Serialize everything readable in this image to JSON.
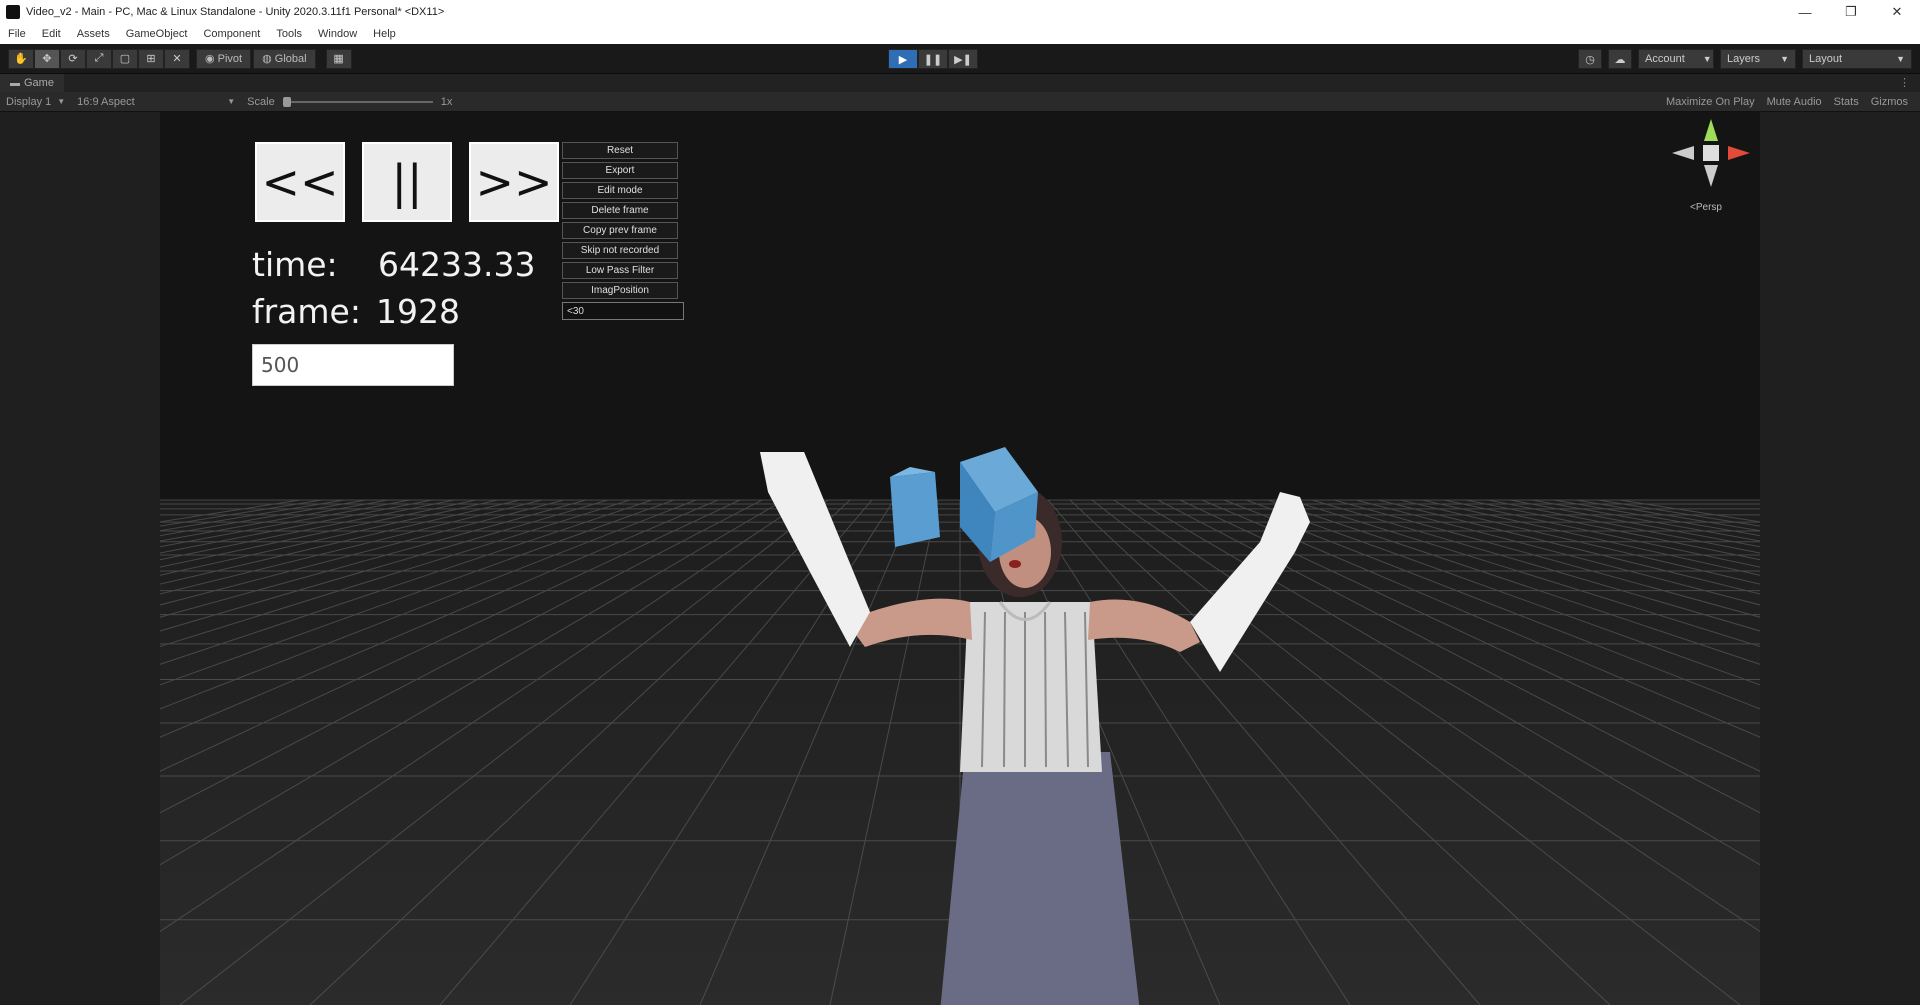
{
  "window": {
    "title": "Video_v2 - Main - PC, Mac & Linux Standalone - Unity 2020.3.11f1 Personal* <DX11>",
    "controls": [
      "—",
      "❐",
      "✕"
    ]
  },
  "menu": {
    "items": [
      "File",
      "Edit",
      "Assets",
      "GameObject",
      "Component",
      "Tools",
      "Window",
      "Help"
    ]
  },
  "toolbar": {
    "pivot_label": "Pivot",
    "global_label": "Global",
    "account_label": "Account",
    "layers_label": "Layers",
    "layout_label": "Layout"
  },
  "game_tab": {
    "label": "Game",
    "menu_icon": "⋮"
  },
  "game_options": {
    "display": "Display 1",
    "aspect": "16:9 Aspect",
    "scale_label": "Scale",
    "scale_value": "1x",
    "maximize": "Maximize On Play",
    "mute": "Mute Audio",
    "stats": "Stats",
    "gizmos": "Gizmos"
  },
  "hud": {
    "prev_label": "<<",
    "pause_label": "||",
    "next_label": ">>",
    "time_label": "time:",
    "time_value": "64233.33",
    "frame_label": "frame:",
    "frame_value": "1928",
    "input_value": "500"
  },
  "side_menu": {
    "items": [
      "Reset",
      "Export",
      "Edit mode",
      "Delete frame",
      "Copy prev frame",
      "Skip not recorded",
      "Low Pass Filter",
      "ImagPosition"
    ],
    "field_value": "<30"
  },
  "gizmo": {
    "label": "<Persp"
  },
  "colors": {
    "play_active": "#2f6db5",
    "cube": "#4b8fc2"
  }
}
